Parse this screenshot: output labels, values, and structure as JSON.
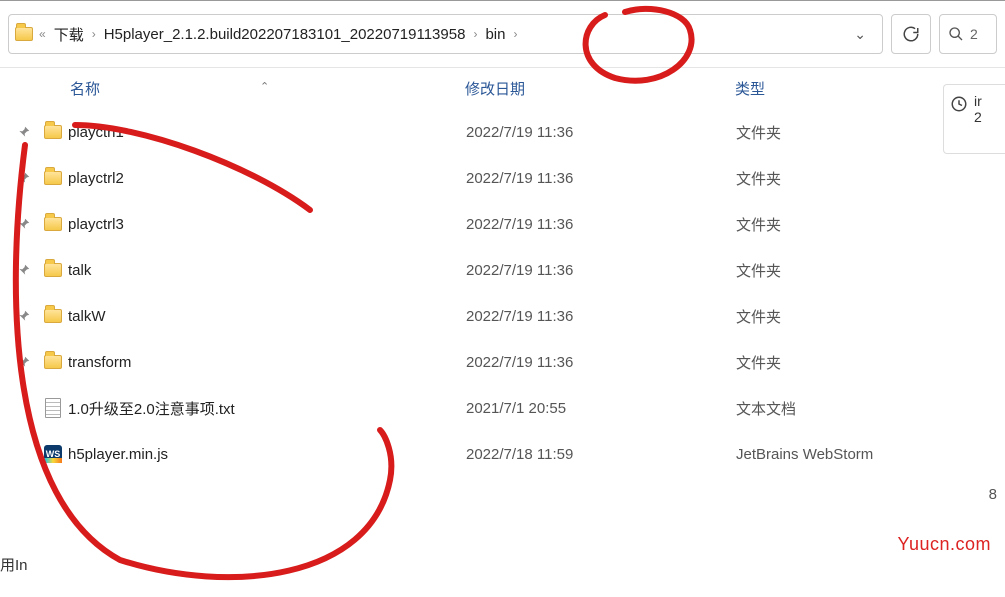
{
  "breadcrumbs": {
    "leading": "«",
    "items": [
      "下载",
      "H5player_2.1.2.build202207183101_20220719113958",
      "bin"
    ]
  },
  "search": {
    "placeholder": "2"
  },
  "columns": {
    "name": "名称",
    "date": "修改日期",
    "type": "类型"
  },
  "files": [
    {
      "icon": "folder",
      "pinned": true,
      "name": "playctrl1",
      "date": "2022/7/19 11:36",
      "type": "文件夹"
    },
    {
      "icon": "folder",
      "pinned": true,
      "name": "playctrl2",
      "date": "2022/7/19 11:36",
      "type": "文件夹"
    },
    {
      "icon": "folder",
      "pinned": true,
      "name": "playctrl3",
      "date": "2022/7/19 11:36",
      "type": "文件夹"
    },
    {
      "icon": "folder",
      "pinned": true,
      "name": "talk",
      "date": "2022/7/19 11:36",
      "type": "文件夹"
    },
    {
      "icon": "folder",
      "pinned": true,
      "name": "talkW",
      "date": "2022/7/19 11:36",
      "type": "文件夹"
    },
    {
      "icon": "folder",
      "pinned": true,
      "name": "transform",
      "date": "2022/7/19 11:36",
      "type": "文件夹"
    },
    {
      "icon": "txt",
      "pinned": false,
      "name": "1.0升级至2.0注意事项.txt",
      "date": "2021/7/1 20:55",
      "type": "文本文档"
    },
    {
      "icon": "ws",
      "pinned": false,
      "name": "h5player.min.js",
      "date": "2022/7/18 11:59",
      "type": "JetBrains WebStorm",
      "size": "8"
    }
  ],
  "rightPanel": {
    "line1": "ir",
    "line2": "2"
  },
  "bottomText": "用In",
  "watermark": "Yuucn.com"
}
